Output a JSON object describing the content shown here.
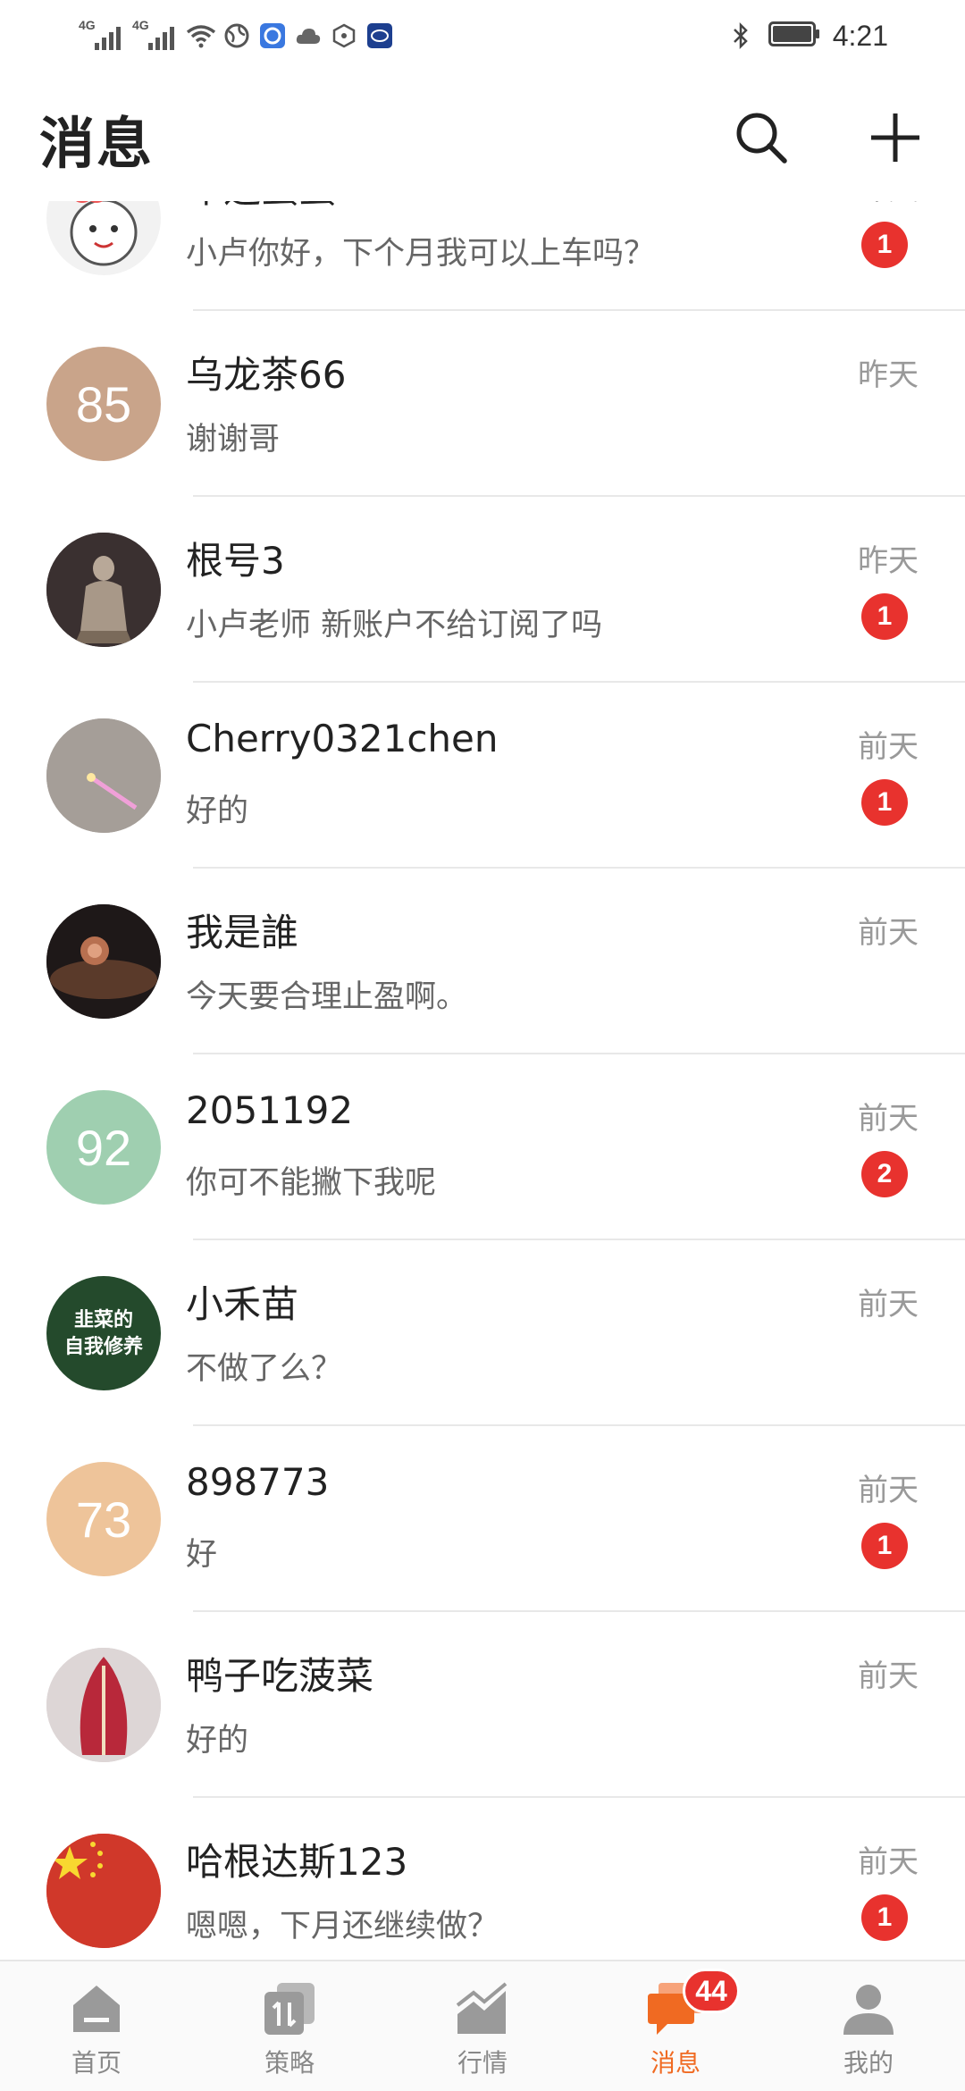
{
  "status_bar": {
    "sim1": "4G",
    "sim2": "4G",
    "time": "4:21"
  },
  "header": {
    "title": "消息"
  },
  "conversations": [
    {
      "name": "叩运蛋蛋",
      "message": "小卢你好，下个月我可以上车吗？",
      "time": "昨天",
      "unread": "1",
      "avatar_text": "",
      "avatar_color": "#f2f2f2"
    },
    {
      "name": "乌龙茶66",
      "message": "谢谢哥",
      "time": "昨天",
      "unread": "",
      "avatar_text": "85",
      "avatar_color": "#c9a48a"
    },
    {
      "name": "根号3",
      "message": "小卢老师  新账户不给订阅了吗",
      "time": "昨天",
      "unread": "1",
      "avatar_text": "",
      "avatar_color": "#3a3030"
    },
    {
      "name": "Cherry0321chen",
      "message": "好的",
      "time": "前天",
      "unread": "1",
      "avatar_text": "",
      "avatar_color": "#a59e98"
    },
    {
      "name": "我是誰",
      "message": "今天要合理止盈啊。",
      "time": "前天",
      "unread": "",
      "avatar_text": "",
      "avatar_color": "#2a2220"
    },
    {
      "name": "2051192",
      "message": "你可不能撇下我呢",
      "time": "前天",
      "unread": "2",
      "avatar_text": "92",
      "avatar_color": "#9fcfb0"
    },
    {
      "name": "小禾苗",
      "message": "不做了么？",
      "time": "前天",
      "unread": "",
      "avatar_text": "韭菜的\n自我修养",
      "avatar_color": "#244a2c"
    },
    {
      "name": "898773",
      "message": "好",
      "time": "前天",
      "unread": "1",
      "avatar_text": "73",
      "avatar_color": "#eec49a"
    },
    {
      "name": "鸭子吃菠菜",
      "message": "好的",
      "time": "前天",
      "unread": "",
      "avatar_text": "",
      "avatar_color": "#d8d0d0"
    },
    {
      "name": "哈根达斯123",
      "message": "嗯嗯，下月还继续做？",
      "time": "前天",
      "unread": "1",
      "avatar_text": "",
      "avatar_color": "#d0382a"
    }
  ],
  "tabs": [
    {
      "label": "首页",
      "icon": "home-icon"
    },
    {
      "label": "策略",
      "icon": "strategy-icon"
    },
    {
      "label": "行情",
      "icon": "market-chart-icon"
    },
    {
      "label": "消息",
      "icon": "message-icon",
      "badge": "44",
      "active": true
    },
    {
      "label": "我的",
      "icon": "profile-icon"
    }
  ],
  "colors": {
    "accent": "#f06a22",
    "badge": "#e8322e",
    "tab_inactive": "#888888"
  }
}
